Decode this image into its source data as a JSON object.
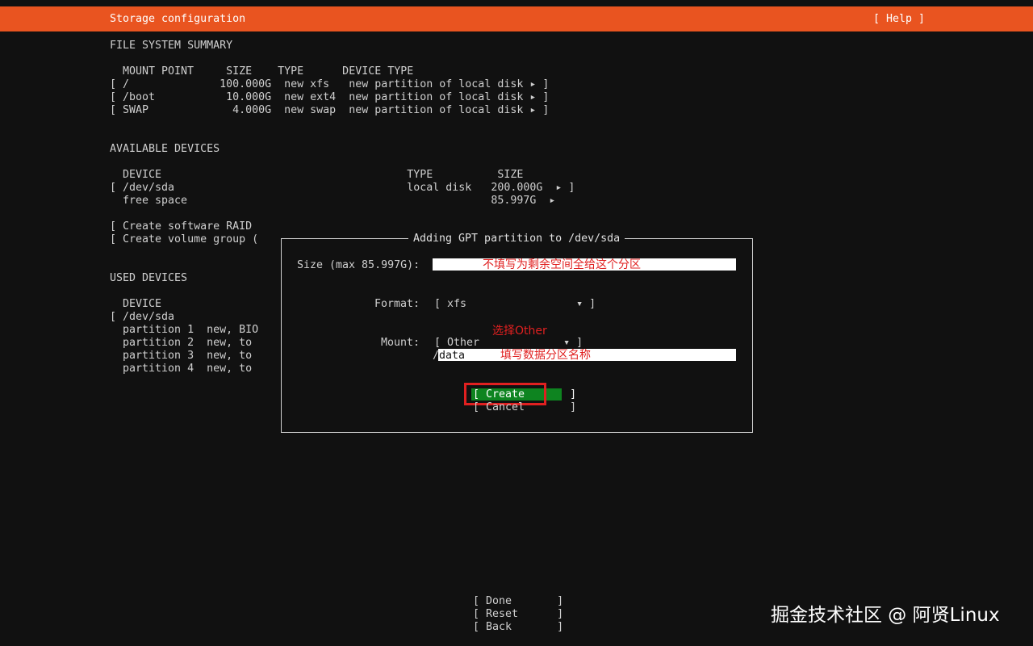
{
  "header": {
    "title": "Storage configuration",
    "help": "[ Help ]"
  },
  "fs_summary": {
    "heading": "FILE SYSTEM SUMMARY",
    "columns": "MOUNT POINT     SIZE    TYPE      DEVICE TYPE",
    "rows": [
      "[ /              100.000G  new xfs   new partition of local disk ▸ ]",
      "[ /boot           10.000G  new ext4  new partition of local disk ▸ ]",
      "[ SWAP             4.000G  new swap  new partition of local disk ▸ ]"
    ]
  },
  "available": {
    "heading": "AVAILABLE DEVICES",
    "columns": "DEVICE                                      TYPE          SIZE",
    "rows": [
      "[ /dev/sda                                    local disk   200.000G  ▸ ]",
      "  free space                                               85.997G  ▸"
    ],
    "actions": [
      "[ Create software RAID",
      "[ Create volume group ("
    ]
  },
  "used": {
    "heading": "USED DEVICES",
    "columns": "DEVICE",
    "rows": [
      "[ /dev/sda",
      "  partition 1  new, BIO",
      "  partition 2  new, to",
      "  partition 3  new, to",
      "  partition 4  new, to"
    ]
  },
  "dialog": {
    "title": "Adding GPT partition to /dev/sda",
    "size_label": "Size (max 85.997G):",
    "format_label": "Format:",
    "format_value": "[ xfs                 ▾ ]",
    "mount_label": "Mount:",
    "mount_value": "[ Other             ▾ ]",
    "mount_path_prefix": "/",
    "mount_path_value": "data",
    "create_label": "[ Create       ]",
    "cancel_label": "[ Cancel       ]"
  },
  "annotations": {
    "size_note": "不填写为剩余空间全给这个分区",
    "mount_note": "选择Other",
    "path_note": "填写数据分区名称"
  },
  "footer": {
    "done": "[ Done       ]",
    "reset": "[ Reset      ]",
    "back": "[ Back       ]"
  },
  "watermark": "掘金技术社区 @ 阿贤Linux",
  "colors": {
    "header": "#e95420",
    "create": "#0e8420",
    "annotation": "#e02020"
  }
}
